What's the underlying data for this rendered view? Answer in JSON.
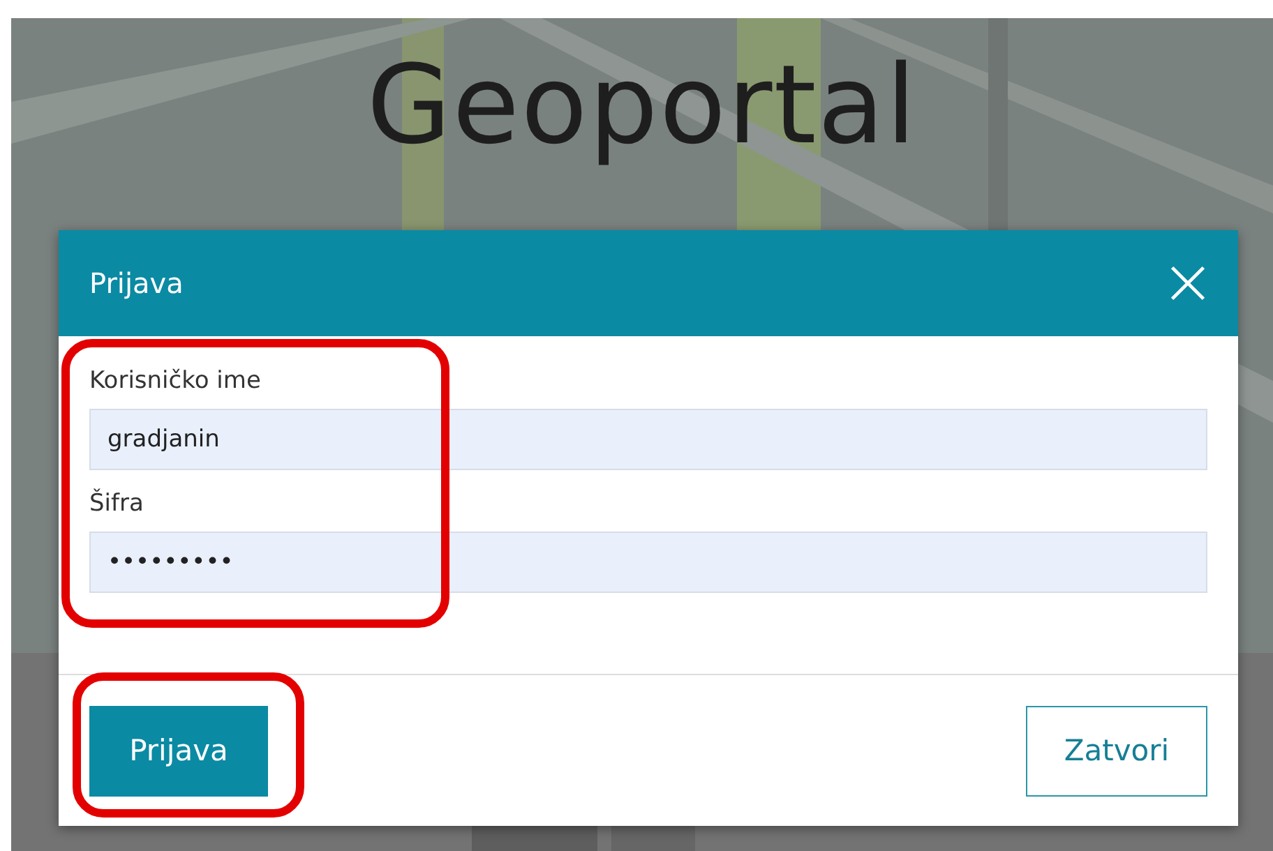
{
  "page": {
    "title": "Geoportal"
  },
  "dialog": {
    "title": "Prijava",
    "fields": [
      {
        "label": "Korisničko ime",
        "value": "gradjanin"
      },
      {
        "label": "Šifra",
        "value": "•••••••••"
      }
    ],
    "buttons": [
      {
        "label": "Prijava",
        "kind": "primary"
      },
      {
        "label": "Zatvori",
        "kind": "secondary"
      }
    ]
  }
}
